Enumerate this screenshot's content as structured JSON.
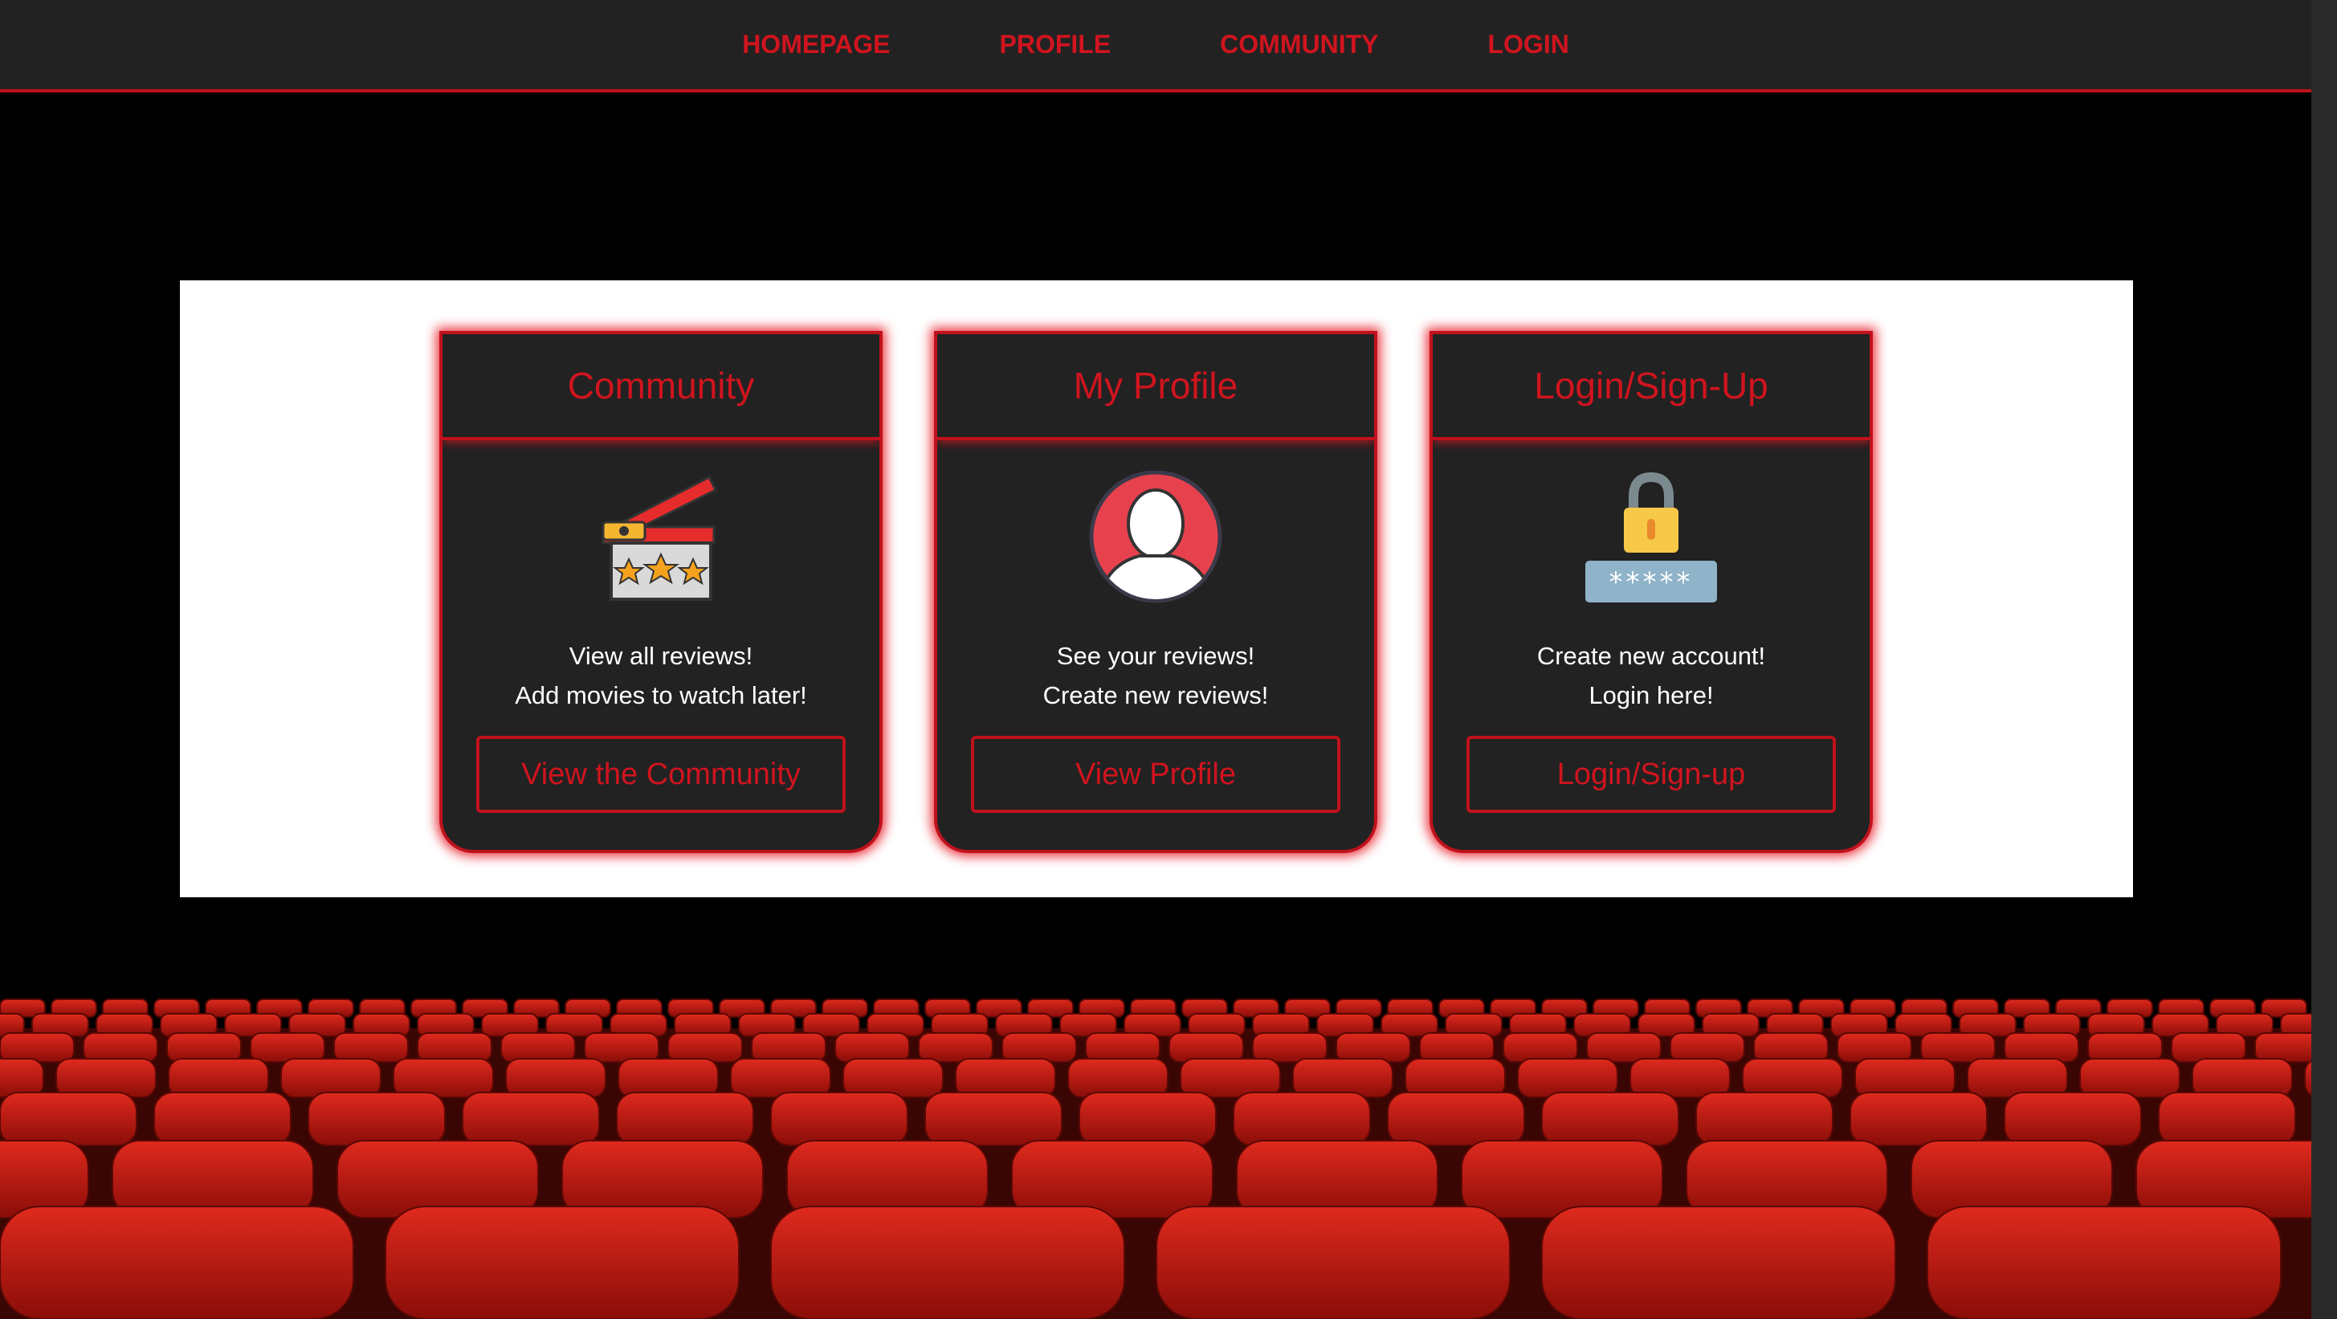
{
  "nav": {
    "items": [
      {
        "label": "HOMEPAGE"
      },
      {
        "label": "PROFILE"
      },
      {
        "label": "COMMUNITY"
      },
      {
        "label": "LOGIN"
      }
    ]
  },
  "cards": [
    {
      "title": "Community",
      "icon": "clapperboard-stars-icon",
      "line1": "View all reviews!",
      "line2": "Add movies to watch later!",
      "button": "View the Community"
    },
    {
      "title": "My Profile",
      "icon": "user-avatar-icon",
      "line1": "See your reviews!",
      "line2": "Create new reviews!",
      "button": "View Profile"
    },
    {
      "title": "Login/Sign-Up",
      "icon": "lock-password-icon",
      "line1": "Create new account!",
      "line2": "Login here!",
      "button": "Login/Sign-up"
    }
  ],
  "colors": {
    "accent": "#d0141e",
    "card_bg": "#222222",
    "nav_bg": "#222222",
    "screen_bg": "#ffffff"
  }
}
